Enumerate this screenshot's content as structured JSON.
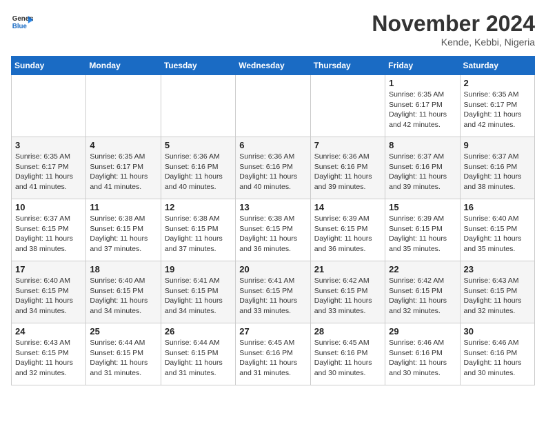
{
  "logo": {
    "line1": "General",
    "line2": "Blue"
  },
  "title": "November 2024",
  "location": "Kende, Kebbi, Nigeria",
  "days_of_week": [
    "Sunday",
    "Monday",
    "Tuesday",
    "Wednesday",
    "Thursday",
    "Friday",
    "Saturday"
  ],
  "weeks": [
    [
      {
        "num": "",
        "info": ""
      },
      {
        "num": "",
        "info": ""
      },
      {
        "num": "",
        "info": ""
      },
      {
        "num": "",
        "info": ""
      },
      {
        "num": "",
        "info": ""
      },
      {
        "num": "1",
        "info": "Sunrise: 6:35 AM\nSunset: 6:17 PM\nDaylight: 11 hours\nand 42 minutes."
      },
      {
        "num": "2",
        "info": "Sunrise: 6:35 AM\nSunset: 6:17 PM\nDaylight: 11 hours\nand 42 minutes."
      }
    ],
    [
      {
        "num": "3",
        "info": "Sunrise: 6:35 AM\nSunset: 6:17 PM\nDaylight: 11 hours\nand 41 minutes."
      },
      {
        "num": "4",
        "info": "Sunrise: 6:35 AM\nSunset: 6:17 PM\nDaylight: 11 hours\nand 41 minutes."
      },
      {
        "num": "5",
        "info": "Sunrise: 6:36 AM\nSunset: 6:16 PM\nDaylight: 11 hours\nand 40 minutes."
      },
      {
        "num": "6",
        "info": "Sunrise: 6:36 AM\nSunset: 6:16 PM\nDaylight: 11 hours\nand 40 minutes."
      },
      {
        "num": "7",
        "info": "Sunrise: 6:36 AM\nSunset: 6:16 PM\nDaylight: 11 hours\nand 39 minutes."
      },
      {
        "num": "8",
        "info": "Sunrise: 6:37 AM\nSunset: 6:16 PM\nDaylight: 11 hours\nand 39 minutes."
      },
      {
        "num": "9",
        "info": "Sunrise: 6:37 AM\nSunset: 6:16 PM\nDaylight: 11 hours\nand 38 minutes."
      }
    ],
    [
      {
        "num": "10",
        "info": "Sunrise: 6:37 AM\nSunset: 6:15 PM\nDaylight: 11 hours\nand 38 minutes."
      },
      {
        "num": "11",
        "info": "Sunrise: 6:38 AM\nSunset: 6:15 PM\nDaylight: 11 hours\nand 37 minutes."
      },
      {
        "num": "12",
        "info": "Sunrise: 6:38 AM\nSunset: 6:15 PM\nDaylight: 11 hours\nand 37 minutes."
      },
      {
        "num": "13",
        "info": "Sunrise: 6:38 AM\nSunset: 6:15 PM\nDaylight: 11 hours\nand 36 minutes."
      },
      {
        "num": "14",
        "info": "Sunrise: 6:39 AM\nSunset: 6:15 PM\nDaylight: 11 hours\nand 36 minutes."
      },
      {
        "num": "15",
        "info": "Sunrise: 6:39 AM\nSunset: 6:15 PM\nDaylight: 11 hours\nand 35 minutes."
      },
      {
        "num": "16",
        "info": "Sunrise: 6:40 AM\nSunset: 6:15 PM\nDaylight: 11 hours\nand 35 minutes."
      }
    ],
    [
      {
        "num": "17",
        "info": "Sunrise: 6:40 AM\nSunset: 6:15 PM\nDaylight: 11 hours\nand 34 minutes."
      },
      {
        "num": "18",
        "info": "Sunrise: 6:40 AM\nSunset: 6:15 PM\nDaylight: 11 hours\nand 34 minutes."
      },
      {
        "num": "19",
        "info": "Sunrise: 6:41 AM\nSunset: 6:15 PM\nDaylight: 11 hours\nand 34 minutes."
      },
      {
        "num": "20",
        "info": "Sunrise: 6:41 AM\nSunset: 6:15 PM\nDaylight: 11 hours\nand 33 minutes."
      },
      {
        "num": "21",
        "info": "Sunrise: 6:42 AM\nSunset: 6:15 PM\nDaylight: 11 hours\nand 33 minutes."
      },
      {
        "num": "22",
        "info": "Sunrise: 6:42 AM\nSunset: 6:15 PM\nDaylight: 11 hours\nand 32 minutes."
      },
      {
        "num": "23",
        "info": "Sunrise: 6:43 AM\nSunset: 6:15 PM\nDaylight: 11 hours\nand 32 minutes."
      }
    ],
    [
      {
        "num": "24",
        "info": "Sunrise: 6:43 AM\nSunset: 6:15 PM\nDaylight: 11 hours\nand 32 minutes."
      },
      {
        "num": "25",
        "info": "Sunrise: 6:44 AM\nSunset: 6:15 PM\nDaylight: 11 hours\nand 31 minutes."
      },
      {
        "num": "26",
        "info": "Sunrise: 6:44 AM\nSunset: 6:15 PM\nDaylight: 11 hours\nand 31 minutes."
      },
      {
        "num": "27",
        "info": "Sunrise: 6:45 AM\nSunset: 6:16 PM\nDaylight: 11 hours\nand 31 minutes."
      },
      {
        "num": "28",
        "info": "Sunrise: 6:45 AM\nSunset: 6:16 PM\nDaylight: 11 hours\nand 30 minutes."
      },
      {
        "num": "29",
        "info": "Sunrise: 6:46 AM\nSunset: 6:16 PM\nDaylight: 11 hours\nand 30 minutes."
      },
      {
        "num": "30",
        "info": "Sunrise: 6:46 AM\nSunset: 6:16 PM\nDaylight: 11 hours\nand 30 minutes."
      }
    ]
  ]
}
